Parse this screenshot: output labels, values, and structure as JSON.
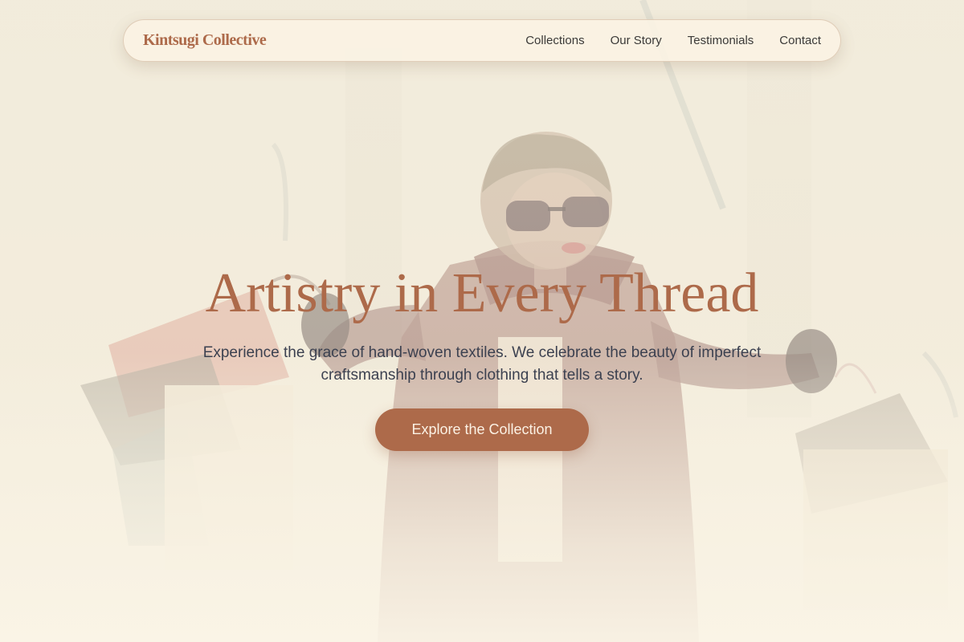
{
  "nav": {
    "brand": "Kintsugi Collective",
    "links": [
      {
        "label": "Collections"
      },
      {
        "label": "Our Story"
      },
      {
        "label": "Testimonials"
      },
      {
        "label": "Contact"
      }
    ]
  },
  "hero": {
    "title": "Artistry in Every Thread",
    "subtitle": "Experience the grace of hand-woven textiles. We celebrate the beauty of imperfect craftsmanship through clothing that tells a story.",
    "cta_label": "Explore the Collection"
  },
  "colors": {
    "accent": "#ad6a4a",
    "background": "#f6efdf",
    "text_dark": "#3c4150",
    "nav_text": "#3b3a38"
  }
}
